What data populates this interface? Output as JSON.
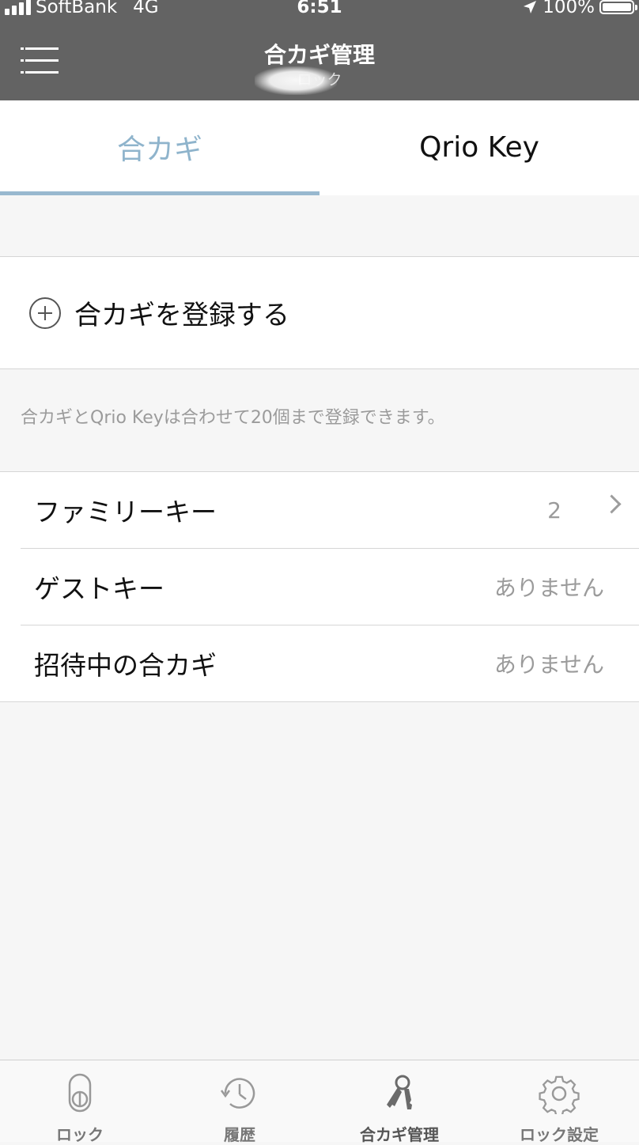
{
  "status_bar": {
    "carrier": "SoftBank",
    "network": "4G",
    "time": "6:51",
    "battery": "100%"
  },
  "header": {
    "title": "合カギ管理",
    "subtitle": "ロック"
  },
  "tabs": [
    {
      "label": "合カギ",
      "active": true
    },
    {
      "label": "Qrio Key",
      "active": false
    }
  ],
  "register": {
    "label": "合カギを登録する"
  },
  "note": "合カギとQrio Keyは合わせて20個まで登録できます。",
  "list": [
    {
      "label": "ファミリーキー",
      "value": "2"
    },
    {
      "label": "ゲストキー",
      "value": "ありません"
    },
    {
      "label": "招待中の合カギ",
      "value": "ありません"
    }
  ],
  "tabbar": [
    {
      "label": "ロック",
      "icon": "lock-icon"
    },
    {
      "label": "履歴",
      "icon": "history-icon"
    },
    {
      "label": "合カギ管理",
      "icon": "keys-icon",
      "active": true
    },
    {
      "label": "ロック設定",
      "icon": "gear-icon"
    }
  ],
  "colors": {
    "header_bg": "#636363",
    "accent": "#98b8cf",
    "background": "#f6f6f6"
  }
}
